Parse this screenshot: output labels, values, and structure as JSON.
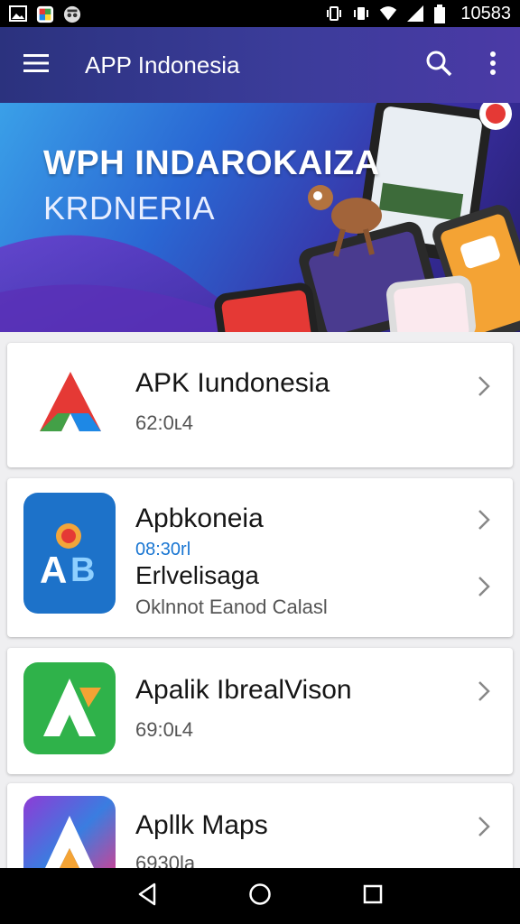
{
  "status_bar": {
    "time": "10583",
    "icons": [
      "image-icon",
      "photos-app-icon",
      "spy-icon",
      "vibrate-icon",
      "vibrate-icon",
      "wifi-icon",
      "signal-icon",
      "battery-icon"
    ]
  },
  "app_bar": {
    "title": "APP Indonesia",
    "menu_icon": "hamburger-menu-icon",
    "search_icon": "search-icon",
    "more_icon": "more-vert-icon"
  },
  "banner": {
    "line1": "WPH INDAROKAIZA",
    "line2": "KRDNERIA"
  },
  "list": [
    {
      "title": "APK Iundonesia",
      "sub": "62:0ʟ4",
      "icon": "apk-logo-icon"
    },
    {
      "title": "Apbkoneia",
      "sub_blue": "08:30rl",
      "title2": "Erlvelisaga",
      "sub2": "Oklnnot Eanod Calasl",
      "icon": "ab-app-icon"
    },
    {
      "title": "Apalik IbrealVison",
      "sub": "69:0ʟ4",
      "icon": "green-a-app-icon"
    },
    {
      "title": "Apllk Maps",
      "sub": "6930la",
      "icon": "maps-a-app-icon"
    }
  ],
  "nav_bar": {
    "back_icon": "back-icon",
    "home_icon": "home-icon",
    "recents_icon": "recents-icon"
  },
  "colors": {
    "app_bar": "#2b327e",
    "accent_blue": "#1976d2",
    "green": "#2fb24a"
  }
}
